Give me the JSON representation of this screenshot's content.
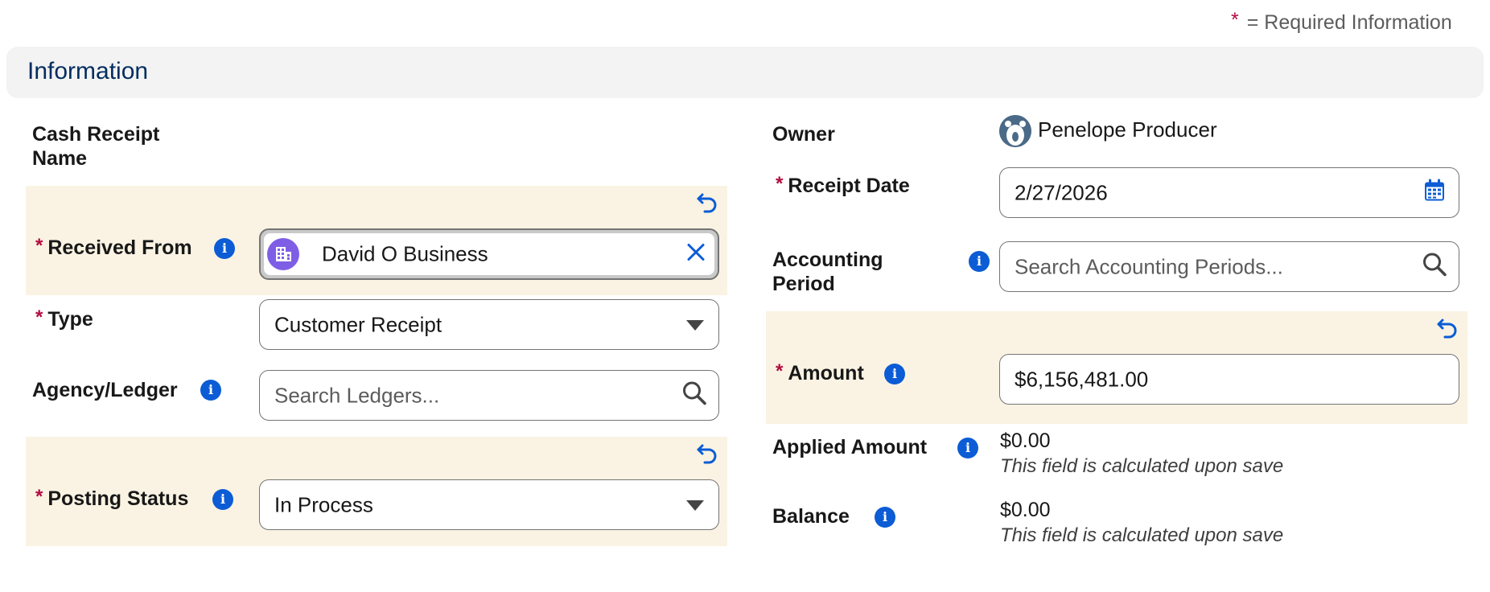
{
  "required_note": {
    "star": "*",
    "text": "= Required Information"
  },
  "section": {
    "title": "Information"
  },
  "left": {
    "cash_receipt_name": {
      "label_line1": "Cash Receipt",
      "label_line2": "Name"
    },
    "received_from": {
      "required": "*",
      "label": "Received From",
      "value": "David O Business"
    },
    "type": {
      "required": "*",
      "label": "Type",
      "value": "Customer Receipt"
    },
    "agency_ledger": {
      "label": "Agency/Ledger",
      "placeholder": "Search Ledgers..."
    },
    "posting_status": {
      "required": "*",
      "label": "Posting Status",
      "value": "In Process"
    }
  },
  "right": {
    "owner": {
      "label": "Owner",
      "value": "Penelope Producer"
    },
    "receipt_date": {
      "required": "*",
      "label": "Receipt Date",
      "value": "2/27/2026"
    },
    "accounting_period": {
      "label_line1": "Accounting",
      "label_line2": "Period",
      "placeholder": "Search Accounting Periods..."
    },
    "amount": {
      "required": "*",
      "label": "Amount",
      "value": "$6,156,481.00"
    },
    "applied_amount": {
      "label": "Applied Amount",
      "value": "$0.00",
      "note": "This field is calculated upon save"
    },
    "balance": {
      "label": "Balance",
      "value": "$0.00",
      "note": "This field is calculated upon save"
    }
  },
  "icons": {
    "info": "i",
    "undo": "undo-icon",
    "calendar": "calendar-icon",
    "search": "search-icon",
    "clear": "close-icon",
    "chevron": "chevron-down-icon",
    "account": "account-icon",
    "avatar": "user-avatar-icon"
  },
  "colors": {
    "required": "#b20c40",
    "info": "#0b5cd5",
    "highlight": "#faf3e3",
    "title": "#032d60"
  }
}
